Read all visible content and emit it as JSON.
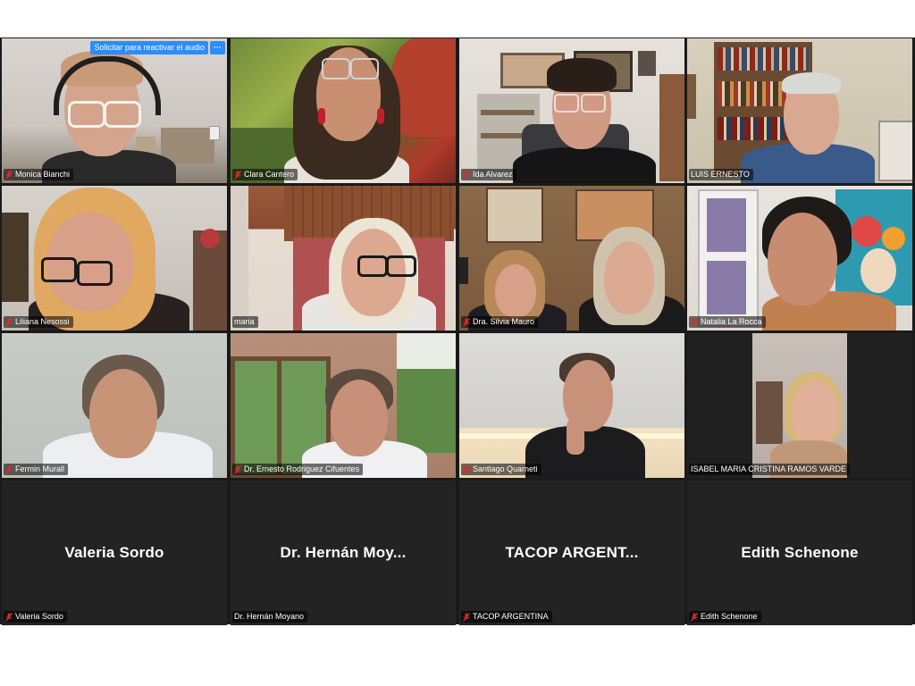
{
  "meeting": {
    "participants": [
      {
        "name": "Monica Bianchi",
        "muted": true,
        "video": true
      },
      {
        "name": "Clara Cantero",
        "muted": true,
        "video": true
      },
      {
        "name": "Ida Alvarez",
        "muted": true,
        "video": true
      },
      {
        "name": "LUIS ERNESTO",
        "muted": false,
        "video": true,
        "active_speaker": true
      },
      {
        "name": "Liliana Nesossi",
        "muted": true,
        "video": true
      },
      {
        "name": "maria",
        "muted": false,
        "video": true
      },
      {
        "name": "Dra. Silvia Mauro",
        "muted": true,
        "video": true
      },
      {
        "name": "Natalia La Rocca",
        "muted": true,
        "video": true
      },
      {
        "name": "Fermin Murall",
        "muted": true,
        "video": true
      },
      {
        "name": "Dr. Ernesto Rodriguez Cifuentes",
        "muted": true,
        "video": true
      },
      {
        "name": "Santiago Quarneti",
        "muted": true,
        "video": true
      },
      {
        "name": "ISABEL MARIA CRISTINA RAMOS VARDE",
        "muted": false,
        "video": true
      },
      {
        "name": "Valeria Sordo",
        "display_name": "Valeria Sordo",
        "muted": true,
        "video": false
      },
      {
        "name": "Dr. Hernán Moyano",
        "display_name": "Dr. Hernán Moy...",
        "muted": false,
        "video": false
      },
      {
        "name": "TACOP ARGENTINA",
        "display_name": "TACOP ARGENT...",
        "muted": true,
        "video": false
      },
      {
        "name": "Edith Schenone",
        "display_name": "Edith Schenone",
        "muted": true,
        "video": false
      }
    ],
    "audio_request": {
      "label": "Solicitar para reactivar el audio",
      "more_label": "···"
    }
  },
  "colors": {
    "active_speaker_border": "#d7e63a",
    "mute_icon": "#e02828",
    "request_button": "#2d8cff",
    "gallery_background": "#1a1a1a"
  }
}
